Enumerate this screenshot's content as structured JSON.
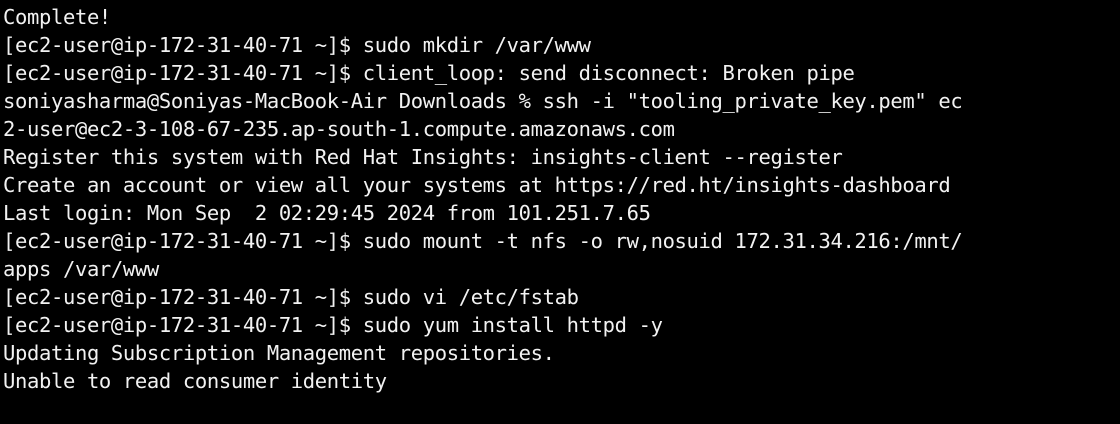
{
  "terminal": {
    "foreground": "#f2f2f2",
    "background": "#000000",
    "lines": [
      "Complete!",
      "[ec2-user@ip-172-31-40-71 ~]$ sudo mkdir /var/www",
      "[ec2-user@ip-172-31-40-71 ~]$ client_loop: send disconnect: Broken pipe",
      "soniyasharma@Soniyas-MacBook-Air Downloads % ssh -i \"tooling_private_key.pem\" ec",
      "2-user@ec2-3-108-67-235.ap-south-1.compute.amazonaws.com",
      "Register this system with Red Hat Insights: insights-client --register",
      "Create an account or view all your systems at https://red.ht/insights-dashboard",
      "Last login: Mon Sep  2 02:29:45 2024 from 101.251.7.65",
      "[ec2-user@ip-172-31-40-71 ~]$ sudo mount -t nfs -o rw,nosuid 172.31.34.216:/mnt/",
      "apps /var/www",
      "[ec2-user@ip-172-31-40-71 ~]$ sudo vi /etc/fstab",
      "[ec2-user@ip-172-31-40-71 ~]$ sudo yum install httpd -y",
      "Updating Subscription Management repositories.",
      "Unable to read consumer identity"
    ]
  }
}
